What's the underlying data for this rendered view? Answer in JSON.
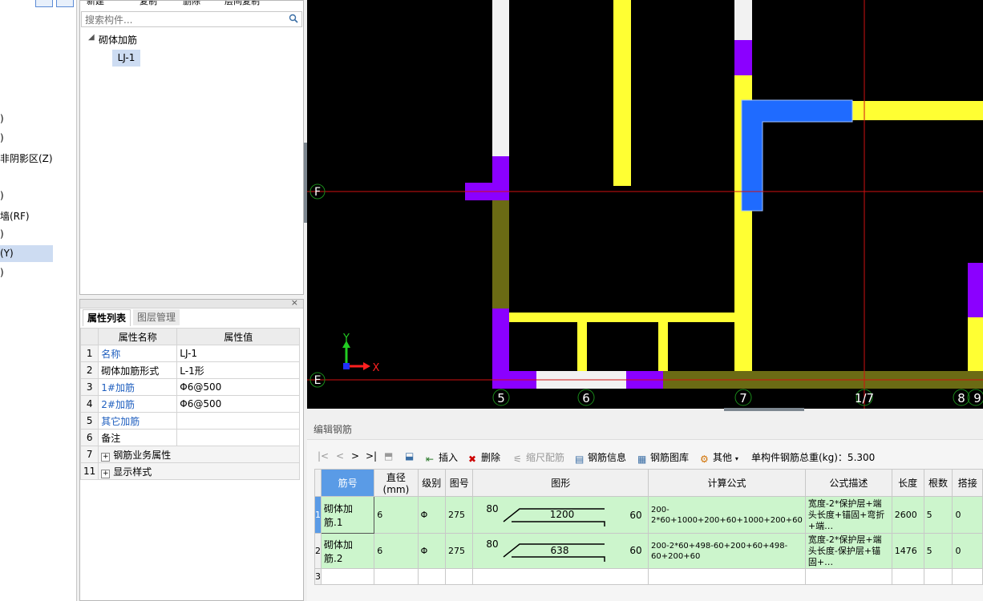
{
  "left_panel": {
    "items": [
      ")",
      ")",
      "非阴影区(Z)",
      ")",
      "墙(RF)",
      ")",
      "(Y)",
      ")"
    ]
  },
  "tree": {
    "toolbar": [
      "新建",
      "复制",
      "删除",
      "层间复制"
    ],
    "search_placeholder": "搜索构件...",
    "group": "砌体加筋",
    "child": "LJ-1"
  },
  "props": {
    "tabs": [
      "属性列表",
      "图层管理"
    ],
    "col_name": "属性名称",
    "col_value": "属性值",
    "rows": [
      {
        "n": "1",
        "name": "名称",
        "value": "LJ-1"
      },
      {
        "n": "2",
        "name": "砌体加筋形式",
        "value": "L-1形"
      },
      {
        "n": "3",
        "name": "1#加筋",
        "value": "Φ6@500"
      },
      {
        "n": "4",
        "name": "2#加筋",
        "value": "Φ6@500"
      },
      {
        "n": "5",
        "name": "其它加筋",
        "value": ""
      },
      {
        "n": "6",
        "name": "备注",
        "value": ""
      },
      {
        "n": "7",
        "name": "钢筋业务属性",
        "value": ""
      },
      {
        "n": "11",
        "name": "显示样式",
        "value": ""
      }
    ]
  },
  "cad": {
    "axis_y": "Y",
    "axis_x": "X",
    "row_labels": [
      "F",
      "E"
    ],
    "col_labels": [
      "5",
      "6",
      "7",
      "1/7",
      "8",
      "9"
    ]
  },
  "editor": {
    "title": "编辑钢筋",
    "toolbar": {
      "insert": "插入",
      "delete": "删除",
      "scale": "缩尺配筋",
      "info": "钢筋信息",
      "library": "钢筋图库",
      "other": "其他",
      "total": "单构件钢筋总重(kg)：5.300"
    },
    "columns": [
      "筋号",
      "直径(mm)",
      "级别",
      "图号",
      "图形",
      "计算公式",
      "公式描述",
      "长度",
      "根数",
      "搭接"
    ],
    "rows": [
      {
        "idx": "1",
        "name": "砌体加筋.1",
        "dia": "6",
        "grade": "Φ",
        "fig": "275",
        "shape_left": "80",
        "shape_mid": "1200",
        "shape_right": "60",
        "formula": "200-2*60+1000+200+60+1000+200+60",
        "desc": "宽度-2*保护层+端头长度+锚固+弯折+端…",
        "len": "2600",
        "count": "5",
        "lap": "0"
      },
      {
        "idx": "2",
        "name": "砌体加筋.2",
        "dia": "6",
        "grade": "Φ",
        "fig": "275",
        "shape_left": "80",
        "shape_mid": "638",
        "shape_right": "60",
        "formula": "200-2*60+498-60+200+60+498-60+200+60",
        "desc": "宽度-2*保护层+端头长度-保护层+锚固+…",
        "len": "1476",
        "count": "5",
        "lap": "0"
      },
      {
        "idx": "3"
      }
    ]
  }
}
